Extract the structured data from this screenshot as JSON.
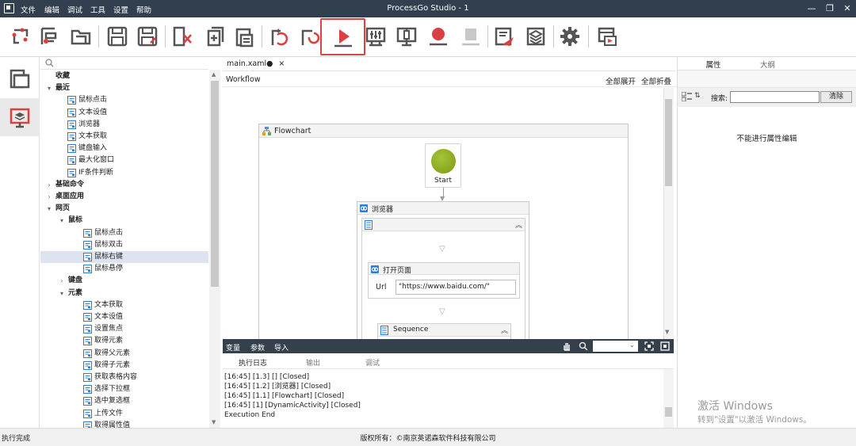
{
  "window": {
    "title": "ProcessGo Studio - 1",
    "menu": [
      "文件",
      "编辑",
      "调试",
      "工具",
      "设置",
      "帮助"
    ],
    "controls": {
      "minimize": "—",
      "maximize": "❐",
      "close": "✕"
    }
  },
  "toolbar": {
    "buttons": [
      {
        "name": "new-flow",
        "icon": "new-flow-icon"
      },
      {
        "name": "new-project",
        "icon": "new-project-icon"
      },
      {
        "name": "open",
        "icon": "open-folder-icon"
      },
      {
        "name": "save",
        "icon": "save-icon"
      },
      {
        "name": "save-as",
        "icon": "save-as-icon"
      },
      {
        "name": "cut",
        "icon": "cut-icon"
      },
      {
        "name": "copy",
        "icon": "copy-icon"
      },
      {
        "name": "paste",
        "icon": "paste-icon"
      },
      {
        "name": "undo",
        "icon": "undo-icon"
      },
      {
        "name": "redo",
        "icon": "redo-icon"
      },
      {
        "name": "run",
        "icon": "run-icon"
      },
      {
        "name": "debug-settings",
        "icon": "sliders-icon"
      },
      {
        "name": "step",
        "icon": "step-icon"
      },
      {
        "name": "record",
        "icon": "record-icon"
      },
      {
        "name": "stop",
        "icon": "stop-icon"
      },
      {
        "name": "publish",
        "icon": "publish-icon"
      },
      {
        "name": "layers",
        "icon": "layers-icon"
      },
      {
        "name": "settings",
        "icon": "gear-icon"
      },
      {
        "name": "export",
        "icon": "export-icon"
      }
    ],
    "highlight_color": "#e04040"
  },
  "tree": {
    "items": [
      {
        "label": "收藏",
        "level": 0,
        "arrow": "",
        "bold": true
      },
      {
        "label": "最近",
        "level": 0,
        "arrow": "▾",
        "bold": true
      },
      {
        "label": "鼠标点击",
        "level": 2,
        "arrow": "",
        "icon": true
      },
      {
        "label": "文本设值",
        "level": 2,
        "arrow": "",
        "icon": true
      },
      {
        "label": "浏览器",
        "level": 2,
        "arrow": "",
        "icon": true
      },
      {
        "label": "文本获取",
        "level": 2,
        "arrow": "",
        "icon": true
      },
      {
        "label": "键盘输入",
        "level": 2,
        "arrow": "",
        "icon": true
      },
      {
        "label": "最大化窗口",
        "level": 2,
        "arrow": "",
        "icon": true
      },
      {
        "label": "IF条件判断",
        "level": 2,
        "arrow": "",
        "icon": true
      },
      {
        "label": "基础命令",
        "level": 0,
        "arrow": "›",
        "bold": true
      },
      {
        "label": "桌面应用",
        "level": 0,
        "arrow": "›",
        "bold": true
      },
      {
        "label": "网页",
        "level": 0,
        "arrow": "▾",
        "bold": true
      },
      {
        "label": "鼠标",
        "level": 1,
        "arrow": "▾",
        "bold": true
      },
      {
        "label": "鼠标点击",
        "level": 3,
        "arrow": "",
        "icon": true
      },
      {
        "label": "鼠标双击",
        "level": 3,
        "arrow": "",
        "icon": true
      },
      {
        "label": "鼠标右键",
        "level": 3,
        "arrow": "",
        "icon": true,
        "selected": true
      },
      {
        "label": "鼠标悬停",
        "level": 3,
        "arrow": "",
        "icon": true
      },
      {
        "label": "键盘",
        "level": 1,
        "arrow": "›",
        "bold": true
      },
      {
        "label": "元素",
        "level": 1,
        "arrow": "▾",
        "bold": true
      },
      {
        "label": "文本获取",
        "level": 3,
        "arrow": "",
        "icon": true
      },
      {
        "label": "文本设值",
        "level": 3,
        "arrow": "",
        "icon": true
      },
      {
        "label": "设置焦点",
        "level": 3,
        "arrow": "",
        "icon": true
      },
      {
        "label": "取得元素",
        "level": 3,
        "arrow": "",
        "icon": true
      },
      {
        "label": "取得父元素",
        "level": 3,
        "arrow": "",
        "icon": true
      },
      {
        "label": "取得子元素",
        "level": 3,
        "arrow": "",
        "icon": true
      },
      {
        "label": "获取表格内容",
        "level": 3,
        "arrow": "",
        "icon": true
      },
      {
        "label": "选择下拉框",
        "level": 3,
        "arrow": "",
        "icon": true
      },
      {
        "label": "选中复选框",
        "level": 3,
        "arrow": "",
        "icon": true
      },
      {
        "label": "上传文件",
        "level": 3,
        "arrow": "",
        "icon": true
      },
      {
        "label": "取得属性值",
        "level": 3,
        "arrow": "",
        "icon": true
      }
    ]
  },
  "editor": {
    "tab_label": "main.xaml●",
    "tab_close": "×",
    "breadcrumb": "Workflow",
    "expand_all": "全部展开",
    "collapse_all": "全部折叠",
    "flowchart": {
      "title": "Flowchart",
      "start_label": "Start",
      "browser_title": "浏览器",
      "open_page_title": "打开页面",
      "url_label": "Url",
      "url_value": "\"https://www.baidu.com/\"",
      "sequence_title": "Sequence"
    }
  },
  "bottom": {
    "bar_tabs": [
      "变量",
      "参数",
      "导入"
    ],
    "log_tabs": [
      "执行日志",
      "输出",
      "调试"
    ],
    "log_lines": [
      "[16:45] [1.3] []  [Closed]",
      "[16:45] [1.2] [浏览器]  [Closed]",
      "[16:45] [1.1] [Flowchart]  [Closed]",
      "[16:45] [1] [DynamicActivity]  [Closed]",
      "Execution End"
    ]
  },
  "properties": {
    "tabs": [
      "属性",
      "大纲"
    ],
    "search_label": "搜索:",
    "clear_button": "清除",
    "empty_message": "不能进行属性编辑"
  },
  "watermark": {
    "line1": "激活 Windows",
    "line2": "转到\"设置\"以激活 Windows。"
  },
  "status": {
    "left": "执行完成",
    "center": "版权所有：©南京英诺森软件科技有限公司"
  },
  "colors": {
    "titlebar": "#313f4e",
    "accent_red": "#d94040",
    "start_green": "#8fae1b"
  }
}
